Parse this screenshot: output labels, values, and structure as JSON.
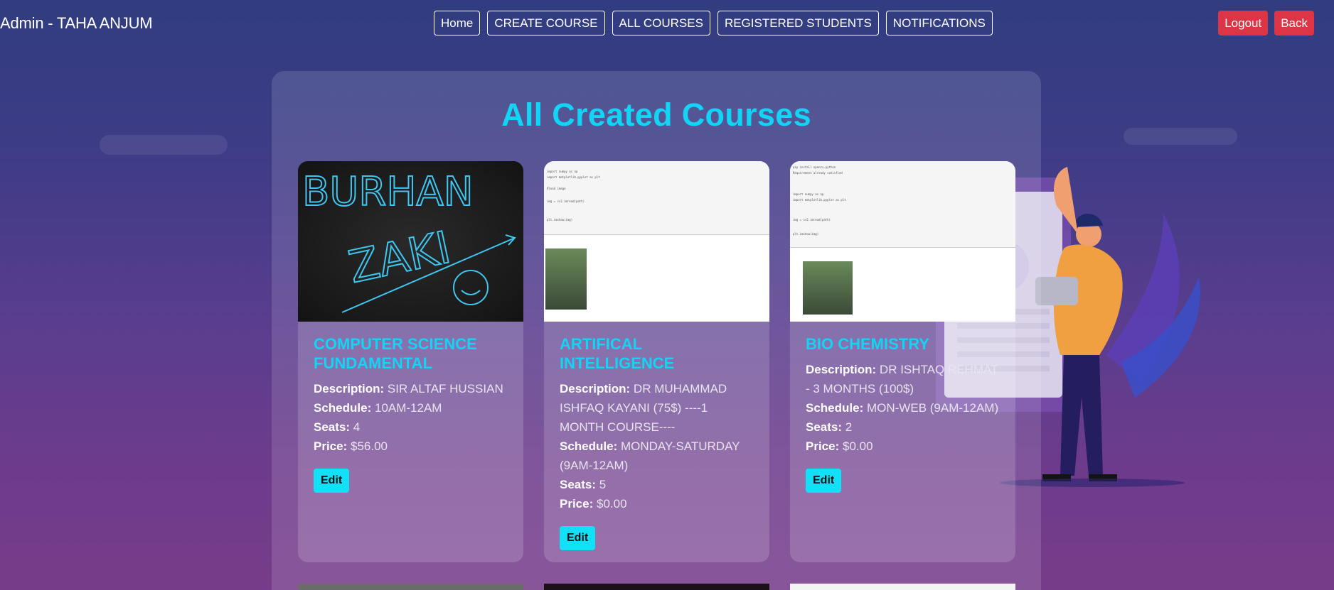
{
  "header": {
    "title": "Admin - TAHA ANJUM",
    "nav": [
      {
        "label": "Home"
      },
      {
        "label": "CREATE COURSE"
      },
      {
        "label": "ALL COURSES"
      },
      {
        "label": "REGISTERED STUDENTS"
      },
      {
        "label": "NOTIFICATIONS"
      }
    ],
    "logout_label": "Logout",
    "back_label": "Back"
  },
  "main": {
    "heading": "All Created Courses",
    "labels": {
      "description": "Description:",
      "schedule": "Schedule:",
      "seats": "Seats:",
      "price": "Price:"
    },
    "edit_label": "Edit",
    "courses": [
      {
        "title": "COMPUTER SCIENCE FUNDAMENTAL",
        "description": "SIR ALTAF HUSSIAN",
        "schedule": "10AM-12AM",
        "seats": "4",
        "price": "$56.00",
        "image_text_1": "BURHAN",
        "image_text_2": "ZAKI"
      },
      {
        "title": "ARTIFICAL INTELLIGENCE",
        "description": "DR MUHAMMAD ISHFAQ KAYANI (75$) ----1 MONTH COURSE----",
        "schedule": "MONDAY-SATURDAY (9AM-12AM)",
        "seats": "5",
        "price": "$0.00"
      },
      {
        "title": "BIO CHEMISTRY",
        "description": "DR ISHTAQ REHMAT - 3 MONTHS (100$)",
        "schedule": "MON-WEB (9AM-12AM)",
        "seats": "2",
        "price": "$0.00"
      }
    ]
  },
  "colors": {
    "accent": "#12d4f6",
    "danger": "#dc3545",
    "edit_button": "#12e0f6"
  }
}
